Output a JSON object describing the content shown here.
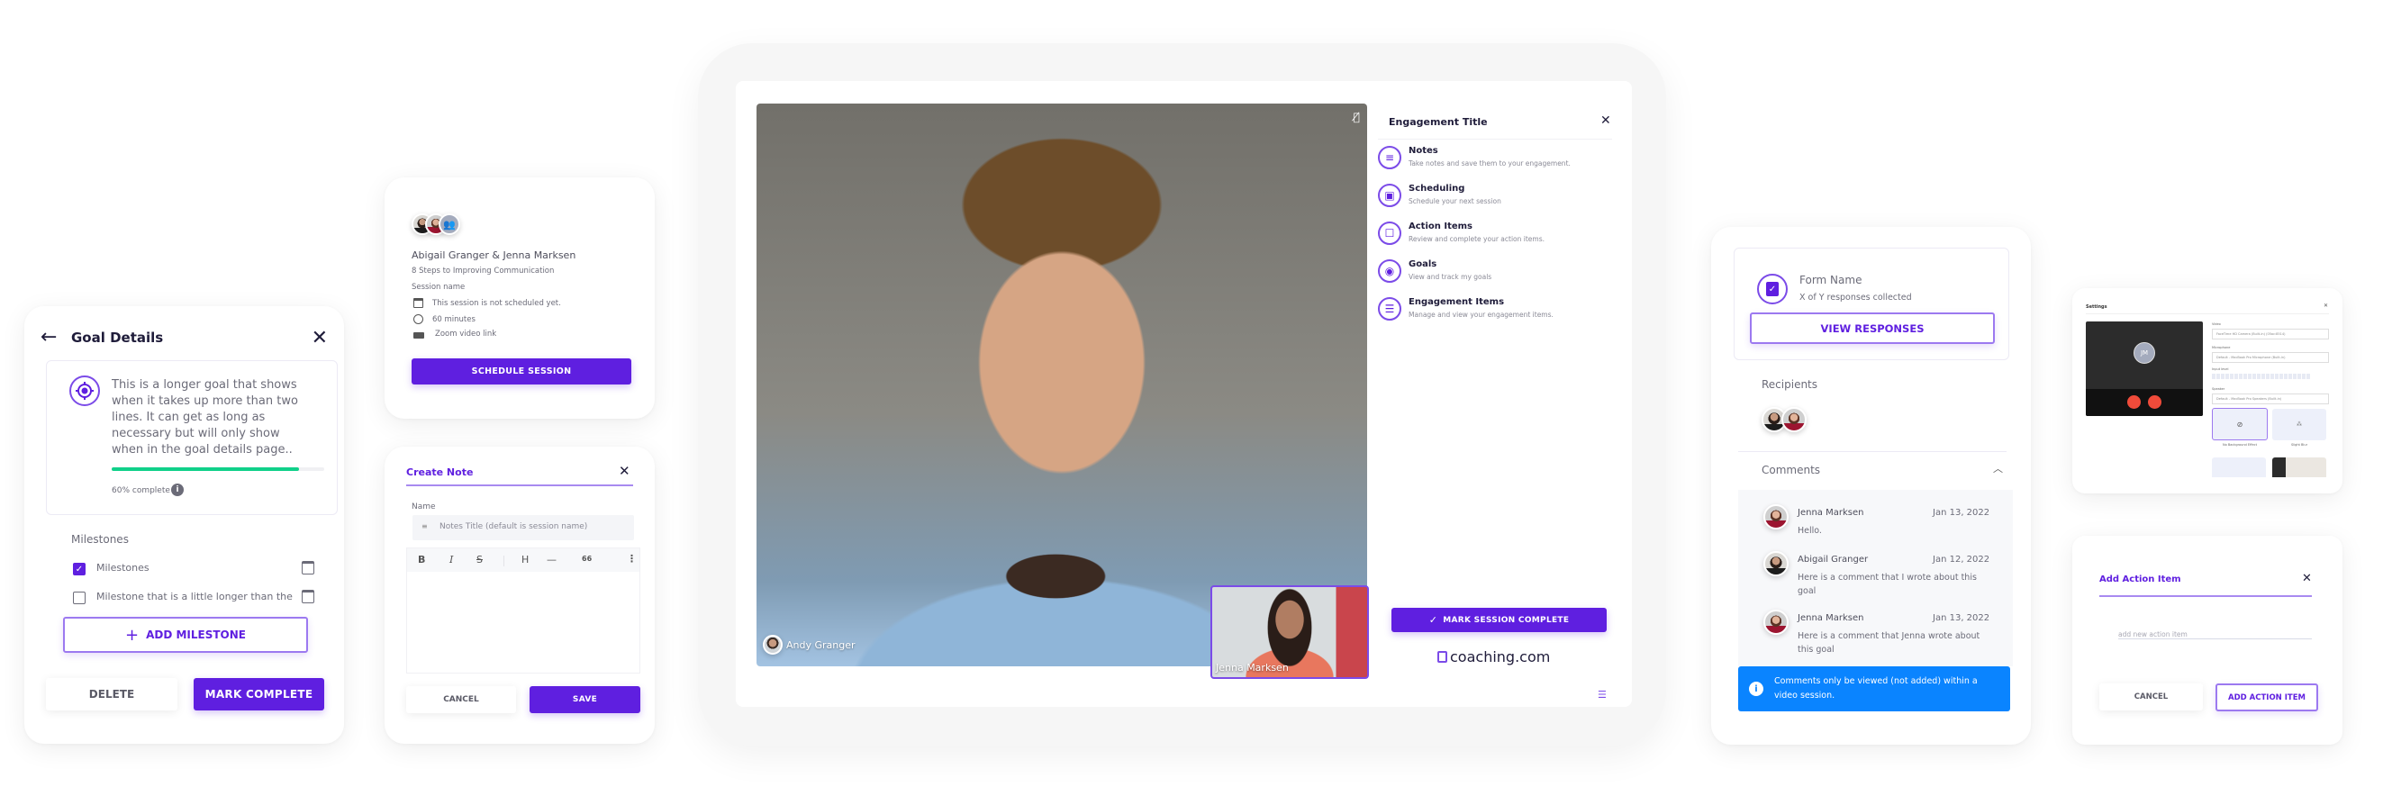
{
  "goal_details": {
    "title": "Goal Details",
    "goal_text": "This is a longer goal that shows when it takes up more than two lines. It can get as long as necessary but will only show when in the goal details page..",
    "progress_percent": 60,
    "progress_label": "60% complete",
    "milestones_heading": "Milestones",
    "milestones": [
      {
        "label": "Milestones",
        "checked": true
      },
      {
        "label": "Milestone that is a little longer than the",
        "checked": false
      }
    ],
    "add_milestone_label": "ADD MILESTONE",
    "delete_label": "DELETE",
    "mark_complete_label": "MARK COMPLETE"
  },
  "session_card": {
    "participants": "Abigail Granger & Jenna Marksen",
    "engagement": "8 Steps to Improving Communication",
    "session_name": "Session name",
    "schedule_status": "This session is not scheduled yet.",
    "duration": "60 minutes",
    "video_link": "Zoom video link",
    "schedule_button": "SCHEDULE SESSION"
  },
  "create_note": {
    "title": "Create Note",
    "name_label": "Name",
    "name_placeholder": "Notes Title (default is session name)",
    "toolbar": [
      "B",
      "I",
      "S",
      "H",
      "—",
      "66",
      "⋮"
    ],
    "cancel_label": "CANCEL",
    "save_label": "SAVE"
  },
  "video_call": {
    "main_participant": "Andy Granger",
    "pip_participant": "Jenna Marksen",
    "panel_title": "Engagement Title",
    "menu": [
      {
        "icon": "notes-icon",
        "title": "Notes",
        "desc": "Take notes and save them to your engagement."
      },
      {
        "icon": "calendar-icon",
        "title": "Scheduling",
        "desc": "Schedule your next session"
      },
      {
        "icon": "checkbox-icon",
        "title": "Action Items",
        "desc": "Review and complete your action items."
      },
      {
        "icon": "target-icon",
        "title": "Goals",
        "desc": "View and track my goals"
      },
      {
        "icon": "list-icon",
        "title": "Engagement Items",
        "desc": "Manage and view your engagement items."
      }
    ],
    "mark_session_complete": "MARK SESSION COMPLETE",
    "brand": "coaching.com"
  },
  "form_card": {
    "form_name": "Form Name",
    "responses": "X of Y responses collected",
    "view_responses": "VIEW RESPONSES",
    "recipients_heading": "Recipients",
    "comments_heading": "Comments",
    "comments": [
      {
        "author": "Jenna Marksen",
        "date": "Jan 13, 2022",
        "text": "Hello.",
        "avatar": "jenna"
      },
      {
        "author": "Abigail Granger",
        "date": "Jan 12, 2022",
        "text": "Here is a comment that I wrote about this goal",
        "avatar": "abigail"
      },
      {
        "author": "Jenna Marksen",
        "date": "Jan 13, 2022",
        "text": "Here is a comment that Jenna wrote about this goal",
        "avatar": "jenna"
      }
    ],
    "info_banner": "Comments only be viewed (not added) within a video session."
  },
  "settings": {
    "title": "Settings",
    "preview_initials": "JM",
    "video_label": "Video",
    "video_value": "FaceTime HD Camera (Built-in) (05ac:8514)",
    "microphone_label": "Microphone",
    "microphone_value": "Default - MacBook Pro Microphone (Built-in)",
    "input_level_label": "Input level",
    "speaker_label": "Speaker",
    "speaker_value": "Default - MacBook Pro Speakers (Built-in)",
    "effects": [
      {
        "label": "No Background Effect",
        "selected": true
      },
      {
        "label": "Slight Blur",
        "selected": false
      }
    ]
  },
  "add_action_item": {
    "title": "Add Action Item",
    "placeholder": "add new action item",
    "cancel_label": "CANCEL",
    "add_label": "ADD ACTION ITEM"
  },
  "colors": {
    "primary": "#5f1fe0",
    "success": "#10d08a",
    "info": "#0a84ff",
    "danger": "#f04b3a"
  }
}
